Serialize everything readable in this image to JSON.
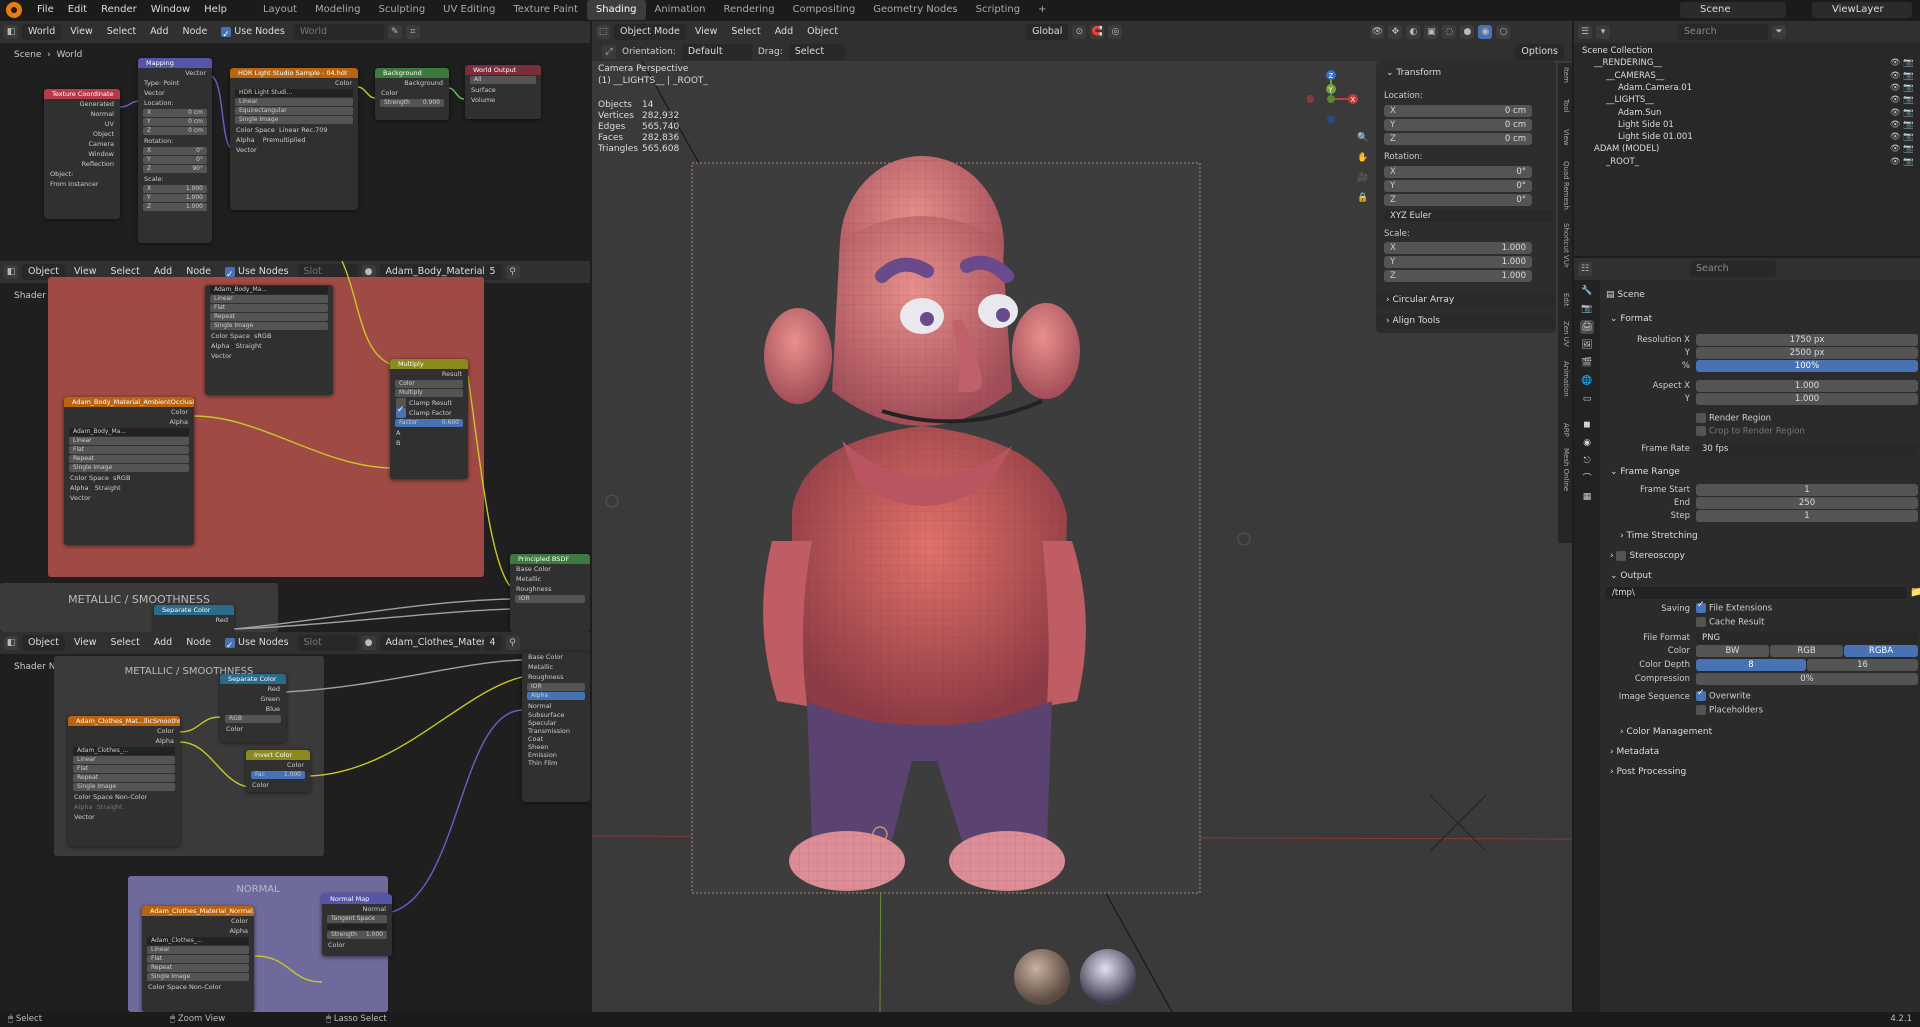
{
  "topbar": {
    "menus": [
      "File",
      "Edit",
      "Render",
      "Window",
      "Help"
    ],
    "workspaces": [
      "Layout",
      "Modeling",
      "Sculpting",
      "UV Editing",
      "Texture Paint",
      "Shading",
      "Animation",
      "Rendering",
      "Compositing",
      "Geometry Nodes",
      "Scripting",
      "+"
    ],
    "active_workspace": "Shading",
    "scene": "Scene",
    "view_layer": "ViewLayer"
  },
  "world_editor": {
    "world_label": "World",
    "menus": [
      "View",
      "Select",
      "Add",
      "Node"
    ],
    "use_nodes": "Use Nodes",
    "world_name": "World",
    "breadcrumb_scene": "Scene",
    "breadcrumb_world": "World",
    "nodes": {
      "texcoord": {
        "title": "Texture Coordinate",
        "outputs": [
          "Generated",
          "Normal",
          "UV",
          "Object",
          "Camera",
          "Window",
          "Reflection"
        ],
        "object_label": "Object:",
        "from_instancer": "From Instancer"
      },
      "mapping": {
        "title": "Mapping",
        "vector_out": "Vector",
        "type_label": "Type:",
        "type_value": "Point",
        "vector_in": "Vector",
        "location": "Location:",
        "rotation": "Rotation:",
        "scale": "Scale:",
        "loc": [
          [
            "X",
            "0 cm"
          ],
          [
            "Y",
            "0 cm"
          ],
          [
            "Z",
            "0 cm"
          ]
        ],
        "rot": [
          [
            "X",
            "0°"
          ],
          [
            "Y",
            "0°"
          ],
          [
            "Z",
            "90°"
          ]
        ],
        "scl": [
          [
            "X",
            "1.000"
          ],
          [
            "Y",
            "1.000"
          ],
          [
            "Z",
            "1.000"
          ]
        ]
      },
      "hdr": {
        "title": "HDR Light Studio Sample - 04.hdr",
        "color_out": "Color",
        "image": "HDR Light Studi...",
        "interp": "Linear",
        "proj": "Equirectangular",
        "ext": "Single Image",
        "cs_label": "Color Space",
        "cs_value": "Linear Rec.709",
        "alpha_label": "Alpha",
        "alpha_value": "Premultiplied",
        "vector": "Vector"
      },
      "background": {
        "title": "Background",
        "out": "Background",
        "color": "Color",
        "strength_label": "Strength",
        "strength_value": "0.900"
      },
      "world_output": {
        "title": "World Output",
        "target": "All",
        "surface": "Surface",
        "volume": "Volume"
      }
    }
  },
  "shader_editor_1": {
    "mode": "Object",
    "menus": [
      "View",
      "Select",
      "Add",
      "Node"
    ],
    "use_nodes": "Use Nodes",
    "slot": "Slot",
    "material": "Adam_Body_Material",
    "users": "5",
    "tree_label": "Shader Nodetree",
    "frame_title": "METALLIC / SMOOTHNESS",
    "node_tex1": {
      "image": "Adam_Body_Ma...",
      "interp": "Linear",
      "proj": "Flat",
      "ext": "Repeat",
      "src": "Single Image",
      "cs_label": "Color Space",
      "cs_value": "sRGB",
      "alpha_label": "Alpha",
      "alpha_value": "Straight",
      "vector": "Vector"
    },
    "node_tex2": {
      "title": "Adam_Body_Material_AmbientOcclusio...",
      "color": "Color",
      "alpha": "Alpha",
      "image": "Adam_Body_Ma...",
      "interp": "Linear",
      "proj": "Flat",
      "ext": "Repeat",
      "src": "Single Image",
      "cs_label": "Color Space",
      "cs_value": "sRGB",
      "alpha_label": "Alpha",
      "alpha_value": "Straight",
      "vector": "Vector"
    },
    "multiply": {
      "title": "Multiply",
      "result": "Result",
      "type": "Color",
      "blend": "Multiply",
      "clamp_result": "Clamp Result",
      "clamp_factor": "Clamp Factor",
      "factor_label": "Factor",
      "factor_value": "0.600",
      "a": "A",
      "b": "B"
    },
    "separate": {
      "title": "Separate Color",
      "red": "Red"
    },
    "bsdf": {
      "title": "Principled BSDF",
      "inputs": [
        "Base Color",
        "Metallic",
        "Roughness",
        "IOR"
      ]
    }
  },
  "shader_editor_2": {
    "mode": "Object",
    "menus": [
      "View",
      "Select",
      "Add",
      "Node"
    ],
    "use_nodes": "Use Nodes",
    "slot": "Slot",
    "material": "Adam_Clothes_Material",
    "users": "4",
    "tree_label": "Shader Nodetree",
    "frame1_title": "METALLIC / SMOOTHNESS",
    "frame2_title": "NORMAL",
    "tex_ms": {
      "title": "Adam_Clothes_Mat...llicSmoothness.png",
      "color": "Color",
      "alpha": "Alpha",
      "image": "Adam_Clothes_...",
      "interp": "Linear",
      "proj": "Flat",
      "ext": "Repeat",
      "src": "Single Image",
      "cs_label": "Color Space",
      "cs_value": "Non-Color",
      "alpha_label": "Alpha",
      "alpha_value": "Straight",
      "vector": "Vector"
    },
    "sep": {
      "title": "Separate Color",
      "outs": [
        "Red",
        "Green",
        "Blue"
      ],
      "mode": "RGB",
      "color": "Color"
    },
    "invert": {
      "title": "Invert Color",
      "color": "Color",
      "fac_label": "Fac",
      "fac_value": "1.000",
      "color_in": "Color"
    },
    "bsdf_inputs": [
      "Base Color",
      "Metallic",
      "Roughness",
      "IOR",
      "Alpha",
      "Normal",
      "Subsurface",
      "Specular",
      "Transmission",
      "Coat",
      "Sheen",
      "Emission",
      "Thin Film"
    ],
    "tex_n": {
      "title": "Adam_Clothes_Material_Normal.png",
      "color": "Color",
      "alpha": "Alpha",
      "image": "Adam_Clothes_...",
      "interp": "Linear",
      "proj": "Flat",
      "ext": "Repeat",
      "src": "Single Image",
      "cs_label": "Color Space",
      "cs_value": "Non-Color"
    },
    "normal_map": {
      "title": "Normal Map",
      "normal": "Normal",
      "space": "Tangent Space",
      "strength_label": "Strength",
      "strength_value": "1.000",
      "color": "Color"
    }
  },
  "viewport": {
    "mode": "Object Mode",
    "menus": [
      "View",
      "Select",
      "Add",
      "Object"
    ],
    "orientation_label": "Orientation:",
    "orientation_value": "Default",
    "drag_label": "Drag:",
    "drag_value": "Select Box",
    "transform_orientation": "Global",
    "options": "Options",
    "camera": "Camera Perspective",
    "collection": "(1) __LIGHTS__ | _ROOT_",
    "stats": [
      [
        "Objects",
        "14"
      ],
      [
        "Vertices",
        "282,932"
      ],
      [
        "Edges",
        "565,740"
      ],
      [
        "Faces",
        "282,836"
      ],
      [
        "Triangles",
        "565,608"
      ]
    ],
    "gizmo": {
      "x": "X",
      "y": "Y",
      "z": "Z"
    },
    "side_tabs": [
      "Item",
      "Tool",
      "View",
      "Quad Remesh",
      "Shortcut VUr",
      "Edit",
      "Zen UV",
      "Animation",
      "ARP",
      "Mesh Online"
    ]
  },
  "transform_panel": {
    "title": "Transform",
    "location": "Location:",
    "rotation": "Rotation:",
    "scale": "Scale:",
    "loc": [
      [
        "X",
        "0 cm"
      ],
      [
        "Y",
        "0 cm"
      ],
      [
        "Z",
        "0 cm"
      ]
    ],
    "rot": [
      [
        "X",
        "0°"
      ],
      [
        "Y",
        "0°"
      ],
      [
        "Z",
        "0°"
      ]
    ],
    "mode": "XYZ Euler",
    "scl": [
      [
        "X",
        "1.000"
      ],
      [
        "Y",
        "1.000"
      ],
      [
        "Z",
        "1.000"
      ]
    ],
    "circular_array": "Circular Array",
    "align_tools": "Align Tools"
  },
  "outliner": {
    "search_placeholder": "Search",
    "rows": [
      {
        "label": "Scene Collection",
        "indent": 0
      },
      {
        "label": "__RENDERING__",
        "indent": 1
      },
      {
        "label": "__CAMERAS__",
        "indent": 2
      },
      {
        "label": "Adam.Camera.01",
        "indent": 3
      },
      {
        "label": "__LIGHTS__",
        "indent": 2
      },
      {
        "label": "Adam.Sun",
        "indent": 3
      },
      {
        "label": "Light Side 01",
        "indent": 3
      },
      {
        "label": "Light Side 01.001",
        "indent": 3
      },
      {
        "label": "ADAM (MODEL)",
        "indent": 1
      },
      {
        "label": "_ROOT_",
        "indent": 2
      }
    ]
  },
  "properties": {
    "search_placeholder": "Search",
    "context": "Scene",
    "format": "Format",
    "res_x_label": "Resolution X",
    "res_x": "1750 px",
    "res_y_label": "Y",
    "res_y": "2500 px",
    "pct_label": "%",
    "pct": "100%",
    "aspect_x_label": "Aspect X",
    "aspect_x": "1.000",
    "aspect_y_label": "Y",
    "aspect_y": "1.000",
    "render_region": "Render Region",
    "crop_region": "Crop to Render Region",
    "frame_rate_label": "Frame Rate",
    "frame_rate": "30 fps",
    "frame_range": "Frame Range",
    "frame_start_label": "Frame Start",
    "frame_start": "1",
    "end_label": "End",
    "end": "250",
    "step_label": "Step",
    "step": "1",
    "time_stretching": "Time Stretching",
    "stereoscopy": "Stereoscopy",
    "output": "Output",
    "path": "/tmp\\",
    "saving_label": "Saving",
    "file_ext": "File Extensions",
    "cache_result": "Cache Result",
    "file_format_label": "File Format",
    "file_format": "PNG",
    "color_label": "Color",
    "color_opts": [
      "BW",
      "RGB",
      "RGBA"
    ],
    "color_selected": "RGBA",
    "depth_label": "Color Depth",
    "depth_opts": [
      "8",
      "16"
    ],
    "depth_selected": "8",
    "compression_label": "Compression",
    "compression": "0%",
    "img_seq_label": "Image Sequence",
    "overwrite": "Overwrite",
    "placeholders": "Placeholders",
    "color_mgmt": "Color Management",
    "metadata": "Metadata",
    "post_processing": "Post Processing"
  },
  "status": {
    "select": "Select",
    "zoom": "Zoom View",
    "lasso": "Lasso Select",
    "version": "4.2.1"
  }
}
